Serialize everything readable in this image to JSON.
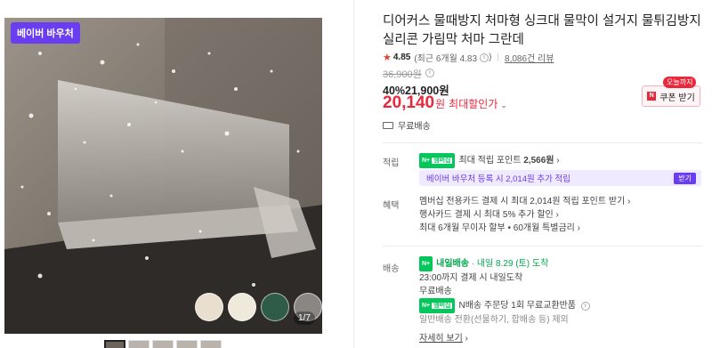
{
  "gallery": {
    "badge": "베이버 바우처",
    "counter": "1/7",
    "swatches": [
      "#e9dfcf",
      "#efe9dc",
      "#2f5c48",
      "#8a8782"
    ],
    "thumb_count": 5
  },
  "product": {
    "title": "디어커스 물때방지 처마형 싱크대 물막이 설거지 물튀김방지 실리콘 가림막 처마 그란데",
    "rating": "4.85",
    "rating_detail": "(최근 6개월 4.83",
    "rating_detail_end": ")",
    "reviews": "8,086건 리뷰",
    "original_price": "36,900원",
    "discount": "40%",
    "sale_price": "21,900원",
    "max_price": "20,140",
    "max_won": "원",
    "max_label": "최대할인가",
    "today_tag": "오늘까지",
    "coupon_label": "쿠폰 받기",
    "shipping": "무료배송"
  },
  "points": {
    "label": "적립",
    "badge": "멤버십",
    "text": "최대 적립 포인트",
    "value": "2,566원",
    "promo": "베이버 바우처 등록 시 2,014원 추가 적립",
    "promo_btn": "받기"
  },
  "benefits": {
    "label": "혜택",
    "items": [
      "멤버십 전용카드 결제 시 최대 2,014원 적립 포인트 받기",
      "행사카드 결제 시 최대 5% 추가 할인",
      "최대 6개월 무이자 할부 • 60개월 특별금리"
    ]
  },
  "delivery": {
    "label": "배송",
    "arrival_badge": "내일배송",
    "arrival": "· 내일 8.29 (토) 도착",
    "cutoff": "23:00까지 결제 시 내일도착",
    "fee": "무료배송",
    "return_badge": "멤버십",
    "return_text": "N배송 주문당 1회 무료교환반품",
    "note": "일반배송 전환(선물하기, 합배송 등) 제외",
    "more": "자세히 보기"
  },
  "colors": {
    "accent_red": "#e8283b",
    "accent_purple": "#6a3df0",
    "naver_green": "#03c75a"
  }
}
